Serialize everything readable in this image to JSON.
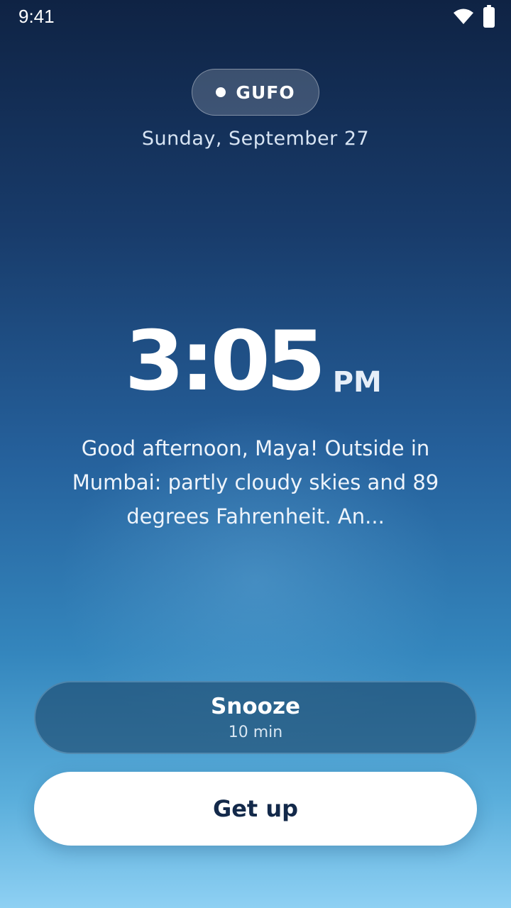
{
  "status_bar": {
    "time": "9:41",
    "icons": [
      "wifi-icon",
      "battery-icon"
    ]
  },
  "badge": {
    "label": "GUFO"
  },
  "date": "Sunday, September 27",
  "clock": {
    "time": "3:05",
    "ampm": "PM"
  },
  "greeting": "Good afternoon, Maya! Outside in Mumbai: partly cloudy skies and 89 degrees Fahrenheit. An...",
  "actions": {
    "snooze_label": "Snooze",
    "snooze_duration": "10 min",
    "getup_label": "Get up"
  },
  "colors": {
    "background_top": "#0f2344",
    "background_bottom": "#8ed0f3",
    "getup_text": "#13294a"
  }
}
